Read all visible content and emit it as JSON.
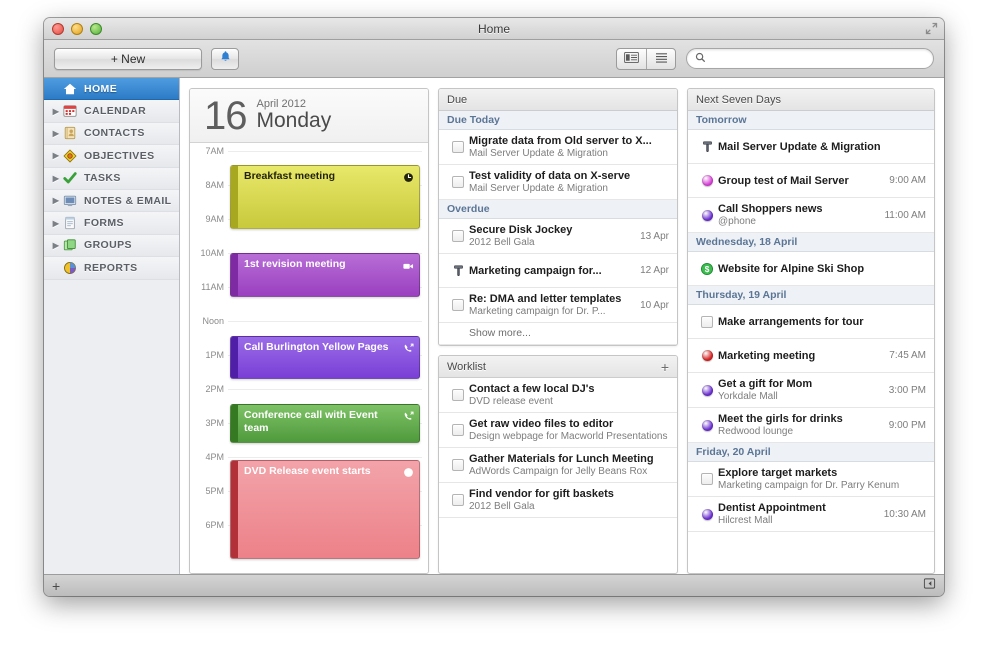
{
  "window": {
    "title": "Home",
    "traffic_lights": [
      "close",
      "minimize",
      "zoom"
    ]
  },
  "toolbar": {
    "new_label": "+ New",
    "bell_icon": "bell-icon",
    "view_list_icon": "view-split-icon",
    "view_rows_icon": "view-rows-icon",
    "search_placeholder": "",
    "search_value": ""
  },
  "sidebar": {
    "items": [
      {
        "label": "HOME",
        "icon": "home-icon",
        "active": true,
        "expandable": false
      },
      {
        "label": "CALENDAR",
        "icon": "calendar-icon",
        "active": false,
        "expandable": true
      },
      {
        "label": "CONTACTS",
        "icon": "contacts-icon",
        "active": false,
        "expandable": true
      },
      {
        "label": "OBJECTIVES",
        "icon": "diamond-icon",
        "active": false,
        "expandable": true
      },
      {
        "label": "TASKS",
        "icon": "check-icon",
        "active": false,
        "expandable": true
      },
      {
        "label": "NOTES & EMAIL",
        "icon": "monitor-icon",
        "active": false,
        "expandable": true
      },
      {
        "label": "FORMS",
        "icon": "form-icon",
        "active": false,
        "expandable": true
      },
      {
        "label": "GROUPS",
        "icon": "groups-icon",
        "active": false,
        "expandable": true
      },
      {
        "label": "REPORTS",
        "icon": "piechart-icon",
        "active": false,
        "expandable": false
      }
    ]
  },
  "day_view": {
    "day_number": "16",
    "month_year": "April 2012",
    "weekday": "Monday",
    "hours": [
      "7AM",
      "8AM",
      "9AM",
      "10AM",
      "11AM",
      "Noon",
      "1PM",
      "2PM",
      "3PM",
      "4PM",
      "5PM",
      "6PM"
    ],
    "events": [
      {
        "title": "Breakfast meeting",
        "start_hour": 7.4,
        "end_hour": 9.3,
        "fill_top": "#e8e86a",
        "fill_bottom": "#c9c93c",
        "stripe": "#a8a820",
        "text_color": "#23230a",
        "icon": "clock-icon"
      },
      {
        "title": "1st revision meeting",
        "start_hour": 10.0,
        "end_hour": 11.3,
        "fill_top": "#b86ed6",
        "fill_bottom": "#9a3fc0",
        "stripe": "#7d2aa3",
        "text_color": "#ffffff",
        "icon": "video-icon"
      },
      {
        "title": "Call Burlington Yellow Pages",
        "start_hour": 12.45,
        "end_hour": 13.7,
        "fill_top": "#9a6ce8",
        "fill_bottom": "#7a3fd6",
        "stripe": "#4f1fa8",
        "text_color": "#ffffff",
        "icon": "phone-icon"
      },
      {
        "title": "Conference call with Event team",
        "start_hour": 14.45,
        "end_hour": 15.6,
        "fill_top": "#7ec266",
        "fill_bottom": "#4f9a3c",
        "stripe": "#357a22",
        "text_color": "#ffffff",
        "icon": "phone-icon"
      },
      {
        "title": "DVD Release event starts",
        "start_hour": 16.1,
        "end_hour": 19.0,
        "fill_top": "#f2a3a9",
        "fill_bottom": "#ed8189",
        "stripe": "#b23038",
        "text_color": "#ffffff",
        "icon": "clock-icon"
      }
    ]
  },
  "due_panel": {
    "title": "Due",
    "groups": [
      {
        "label": "Due Today",
        "items": [
          {
            "mark": "checkbox",
            "title": "Migrate data from Old server to X...",
            "subtitle": "Mail Server Update & Migration",
            "meta": ""
          },
          {
            "mark": "checkbox",
            "title": "Test validity of data on X-serve",
            "subtitle": "Mail Server Update & Migration",
            "meta": ""
          }
        ]
      },
      {
        "label": "Overdue",
        "items": [
          {
            "mark": "checkbox",
            "title": "Secure Disk Jockey",
            "subtitle": "2012 Bell Gala",
            "meta": "13 Apr"
          },
          {
            "mark": "hammer",
            "title": "Marketing campaign for...",
            "subtitle": "",
            "meta": "12 Apr"
          },
          {
            "mark": "checkbox",
            "title": "Re: DMA and letter templates",
            "subtitle": "Marketing campaign for Dr. P...",
            "meta": "10 Apr"
          }
        ]
      }
    ],
    "show_more": "Show more..."
  },
  "worklist_panel": {
    "title": "Worklist",
    "add_icon": "plus-icon",
    "items": [
      {
        "mark": "checkbox",
        "title": "Contact a few local DJ's",
        "subtitle": "DVD release event"
      },
      {
        "mark": "checkbox",
        "title": "Get raw video files to editor",
        "subtitle": "Design webpage for Macworld Presentations"
      },
      {
        "mark": "checkbox",
        "title": "Gather Materials for Lunch Meeting",
        "subtitle": "AdWords Campaign for Jelly Beans Rox"
      },
      {
        "mark": "checkbox",
        "title": "Find vendor for gift baskets",
        "subtitle": "2012 Bell Gala"
      }
    ]
  },
  "next_seven_days": {
    "title": "Next Seven Days",
    "groups": [
      {
        "label": "Tomorrow",
        "items": [
          {
            "mark": "hammer",
            "title": "Mail Server Update & Migration",
            "subtitle": "",
            "meta": ""
          },
          {
            "mark": "dot",
            "dot_color": "#d63fd6",
            "title": "Group test of Mail Server",
            "subtitle": "",
            "meta": "9:00 AM"
          },
          {
            "mark": "dot",
            "dot_color": "#6b2fd0",
            "title": "Call Shoppers news",
            "subtitle": "@phone",
            "meta": "11:00 AM"
          }
        ]
      },
      {
        "label": "Wednesday, 18 April",
        "items": [
          {
            "mark": "dollar",
            "title": "Website for Alpine Ski Shop",
            "subtitle": "",
            "meta": ""
          }
        ]
      },
      {
        "label": "Thursday, 19 April",
        "items": [
          {
            "mark": "checkbox",
            "title": "Make arrangements for tour",
            "subtitle": "",
            "meta": ""
          },
          {
            "mark": "dot",
            "dot_color": "#d62222",
            "title": "Marketing meeting",
            "subtitle": "",
            "meta": "7:45 AM"
          },
          {
            "mark": "dot",
            "dot_color": "#6b2fd0",
            "title": "Get a gift for Mom",
            "subtitle": "Yorkdale Mall",
            "meta": "3:00 PM"
          },
          {
            "mark": "dot",
            "dot_color": "#6b2fd0",
            "title": "Meet the girls for drinks",
            "subtitle": "Redwood lounge",
            "meta": "9:00 PM"
          }
        ]
      },
      {
        "label": "Friday, 20 April",
        "items": [
          {
            "mark": "checkbox",
            "title": "Explore target markets",
            "subtitle": "Marketing campaign for Dr. Parry Kenum",
            "meta": ""
          },
          {
            "mark": "dot",
            "dot_color": "#6b2fd0",
            "title": "Dentist Appointment",
            "subtitle": "Hilcrest Mall",
            "meta": "10:30 AM"
          }
        ]
      }
    ]
  },
  "statusbar": {
    "add_label": "+",
    "panel_toggle_icon": "panel-toggle-icon"
  },
  "colors": {
    "accent": "#2c7bc6",
    "group_label": "#5b7596",
    "window_bg": "#d8d8d8"
  }
}
